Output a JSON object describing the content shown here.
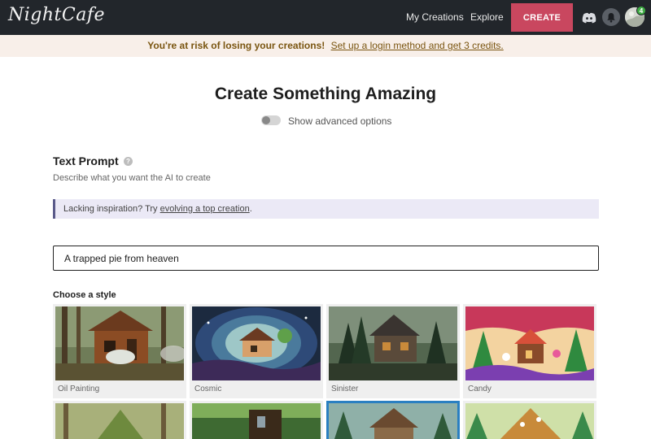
{
  "app": {
    "logo_text": "NightCafe"
  },
  "nav": {
    "my_creations": "My Creations",
    "explore": "Explore",
    "create": "CREATE",
    "notification_count": "4"
  },
  "banner": {
    "warning": "You're at risk of losing your creations!",
    "link": "Set up a login method and get 3 credits."
  },
  "page": {
    "title": "Create Something Amazing",
    "advanced_toggle_label": "Show advanced options"
  },
  "prompt_section": {
    "title": "Text Prompt",
    "help_glyph": "?",
    "description": "Describe what you want the AI to create",
    "inspiration_prefix": "Lacking inspiration? Try ",
    "inspiration_link": "evolving a top creation",
    "inspiration_suffix": ".",
    "input_value": "A trapped pie from heaven"
  },
  "styles": {
    "heading": "Choose a style",
    "items": [
      {
        "label": "Oil Painting"
      },
      {
        "label": "Cosmic"
      },
      {
        "label": "Sinister"
      },
      {
        "label": "Candy"
      }
    ]
  },
  "colors": {
    "topbar": "#22262b",
    "create_button": "#c9475f",
    "banner_bg": "#f8efe9",
    "banner_text": "#7a5510",
    "inspire_bg": "#ebe9f6",
    "selected_border": "#2a7fc1"
  },
  "icons": {
    "discord": "discord-icon",
    "bell": "bell-icon",
    "avatar": "avatar",
    "help": "help-icon"
  }
}
